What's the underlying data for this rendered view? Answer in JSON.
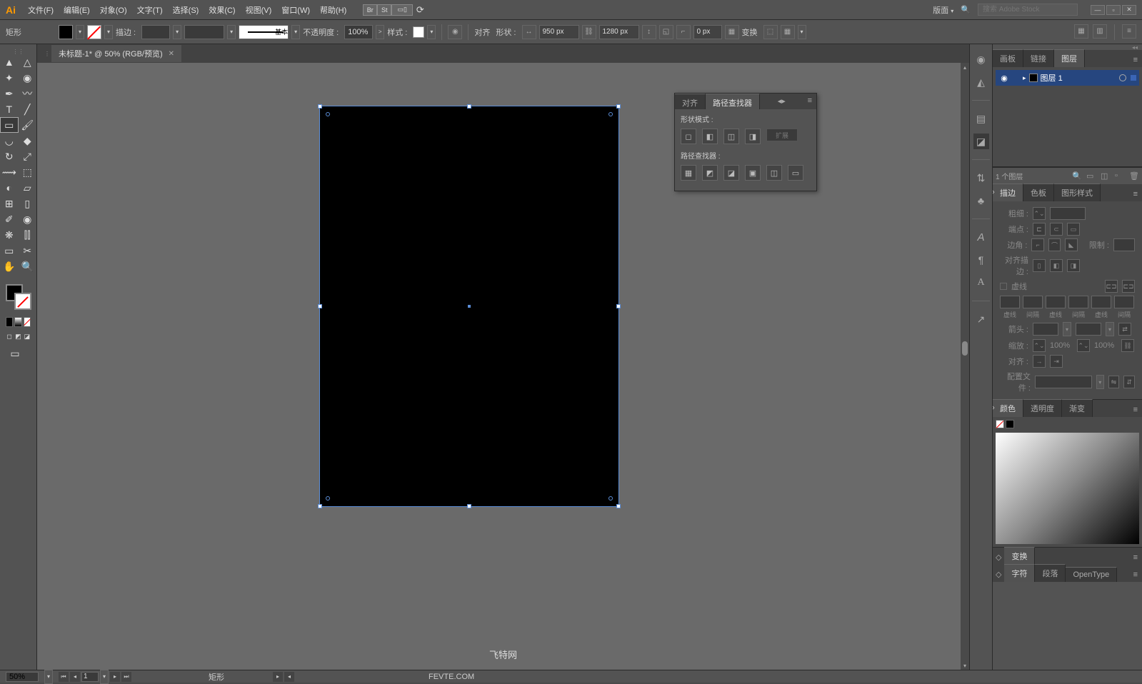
{
  "app": {
    "logo": "Ai"
  },
  "menu": {
    "file": "文件(F)",
    "edit": "编辑(E)",
    "object": "对象(O)",
    "type": "文字(T)",
    "select": "选择(S)",
    "effect": "效果(C)",
    "view": "视图(V)",
    "window": "窗口(W)",
    "help": "帮助(H)"
  },
  "menubar_right": {
    "br": "Br",
    "st": "St",
    "workspace_label": "版面",
    "search_placeholder": "搜索 Adobe Stock"
  },
  "control": {
    "shape": "矩形",
    "stroke_label": "描边 :",
    "profile_label": "基本",
    "opacity_label": "不透明度 :",
    "opacity_value": "100%",
    "style_label": "样式 :",
    "align_label": "对齐",
    "shape_btn": "形状 :",
    "width": "950 px",
    "height": "1280 px",
    "corner": "0 px",
    "transform_label": "变换"
  },
  "doc": {
    "tab": "未标题-1* @ 50% (RGB/预览)"
  },
  "pathfinder": {
    "tab_align": "对齐",
    "tab_pf": "路径查找器",
    "shape_modes": "形状模式 :",
    "expand": "扩展",
    "pf_label": "路径查找器 :"
  },
  "panels": {
    "tab_artboard": "画板",
    "tab_links": "链接",
    "tab_layers": "图层",
    "layer_name": "图层 1",
    "layer_count": "1 个图层",
    "tab_stroke": "描边",
    "tab_color": "色板",
    "tab_graphic": "图形样式",
    "stroke_weight": "粗细 :",
    "stroke_cap": "端点 :",
    "stroke_corner": "边角 :",
    "stroke_limit": "限制 :",
    "stroke_align": "对齐描边 :",
    "dashed": "虚线",
    "dash1": "虚线",
    "gap1": "间隔",
    "dash2": "虚线",
    "gap2": "间隔",
    "dash3": "虚线",
    "gap3": "间隔",
    "arrow": "箭头 :",
    "scale": "缩放 :",
    "scale_val": "100%",
    "align_arrow": "对齐 :",
    "profile": "配置文件 :",
    "tab_colortab": "颜色",
    "tab_transparency": "透明度",
    "tab_gradient": "渐变",
    "tab_transform": "变换",
    "tab_char": "字符",
    "tab_para": "段落",
    "tab_opentype": "OpenType"
  },
  "status": {
    "zoom": "50%",
    "page": "1",
    "sel": "矩形"
  },
  "watermark": {
    "cn": "飞特网",
    "en": "FEVTE.COM"
  }
}
